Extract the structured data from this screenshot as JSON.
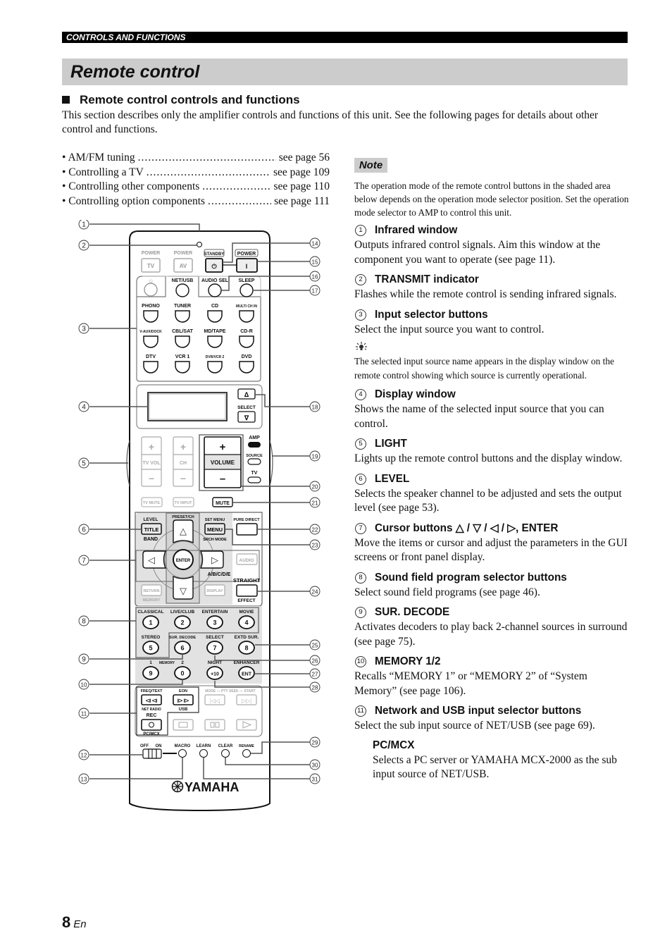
{
  "header": {
    "section": "CONTROLS AND FUNCTIONS"
  },
  "title": "Remote control",
  "section_heading": "Remote control controls and functions",
  "intro": "This section describes only the amplifier controls and functions of this unit. See the following pages for details about other control and functions.",
  "references": [
    {
      "label": "• AM/FM tuning",
      "page": "see page 56"
    },
    {
      "label": "• Controlling a TV",
      "page": "see page 109"
    },
    {
      "label": "• Controlling other components",
      "page": "see page 110"
    },
    {
      "label": "• Controlling option components",
      "page": "see page 111"
    }
  ],
  "note": {
    "label": "Note",
    "text": "The operation mode of the remote control buttons in the shaded area below depends on the operation mode selector position. Set the operation mode selector to AMP to control this unit."
  },
  "items": [
    {
      "num": "1",
      "title": "Infrared window",
      "body": "Outputs infrared control signals. Aim this window at the component you want to operate (see page 11)."
    },
    {
      "num": "2",
      "title": "TRANSMIT indicator",
      "body": "Flashes while the remote control is sending infrared signals."
    },
    {
      "num": "3",
      "title": "Input selector buttons",
      "body": "Select the input source you want to control.",
      "tip_icon": "lightbulb-icon",
      "tip": "The selected input source name appears in the display window on the remote control showing which source is currently operational."
    },
    {
      "num": "4",
      "title": "Display window",
      "body": "Shows the name of the selected input source that you can control."
    },
    {
      "num": "5",
      "title": "LIGHT",
      "body": "Lights up the remote control buttons and the display window."
    },
    {
      "num": "6",
      "title": "LEVEL",
      "body": "Selects the speaker channel to be adjusted and sets the output level (see page 53)."
    },
    {
      "num": "7",
      "title": "Cursor buttons △ / ▽ / ◁ / ▷, ENTER",
      "body": "Move the items or cursor and adjust the parameters in the GUI screens or front panel display."
    },
    {
      "num": "8",
      "title": "Sound field program selector buttons",
      "body": "Select sound field programs (see page 46)."
    },
    {
      "num": "9",
      "title": "SUR. DECODE",
      "body": "Activates decoders to play back 2-channel sources in surround (see page 75)."
    },
    {
      "num": "10",
      "title": "MEMORY 1/2",
      "body": "Recalls “MEMORY 1” or “MEMORY 2” of “System Memory” (see page 106)."
    },
    {
      "num": "11",
      "title": "Network and USB input selector buttons",
      "body": "Select the sub input source of NET/USB (see page 69).",
      "sub": {
        "title": "PC/MCX",
        "body": "Selects a PC server or YAMAHA MCX-2000 as the sub input source of NET/USB."
      }
    }
  ],
  "remote": {
    "power_labels": [
      "POWER",
      "POWER",
      "STANDBY",
      "POWER"
    ],
    "power_buttons": [
      "TV",
      "AV",
      "⏻",
      "I"
    ],
    "star": "☆",
    "top_row": [
      "NET/USB",
      "AUDIO SEL",
      "SLEEP"
    ],
    "inputs": [
      [
        "PHONO",
        "TUNER",
        "CD",
        "MULTI CH IN"
      ],
      [
        "V-AUX/DOCK",
        "CBL/SAT",
        "MD/TAPE",
        "CD-R"
      ],
      [
        "DTV",
        "VCR 1",
        "DVR/VCR 2",
        "DVD"
      ]
    ],
    "select_label": "SELECT",
    "select_up": "Δ",
    "select_down": "∇",
    "plus": "+",
    "minus": "–",
    "tv_vol": "TV VOL",
    "ch": "CH",
    "volume": "VOLUME",
    "mode_labels": [
      "AMP",
      "SOURCE",
      "TV"
    ],
    "tv_mute": "TV MUTE",
    "tv_input": "TV INPUT",
    "mute": "MUTE",
    "level": "LEVEL",
    "title_btn": "TITLE",
    "band": "BAND",
    "preset_ch": "PRESET/CH",
    "set_menu": "SET MENU",
    "menu_btn": "MENU",
    "srch_mode": "SRCH MODE",
    "pure_direct": "PURE DIRECT",
    "enter": "ENTER",
    "audio": "AUDIO",
    "abcde": "A/B/C/D/E",
    "straight": "STRAIGHT",
    "effect": "EFFECT",
    "return_btn": "RETURN",
    "memory_sub": "MEMORY",
    "display_btn": "DISPLAY",
    "programs": [
      "CLASSICAL",
      "LIVE/CLUB",
      "ENTERTAIN",
      "MOVIE",
      "STEREO",
      "SUR. DECODE",
      "SELECT",
      "EXTD SUR."
    ],
    "numbers": [
      "1",
      "2",
      "3",
      "4",
      "5",
      "6",
      "7",
      "8",
      "9",
      "0",
      "+10",
      "ENT"
    ],
    "memory_row": [
      "1",
      "MEMORY",
      "2",
      "NIGHT",
      "ENHANCER"
    ],
    "freq_text": "FREQ/TEXT",
    "eon": "EON",
    "net_radio": "NET RADIO",
    "usb": "USB",
    "rec": "REC",
    "pc_mcx": "PC/MCX",
    "mode_pty": "MODE — PTY SEEK — START",
    "off": "OFF",
    "on": "ON",
    "bottom": [
      "MACRO",
      "LEARN",
      "CLEAR",
      "RENAME"
    ],
    "brand": "YAMAHA",
    "callouts_left": [
      "1",
      "2",
      "3",
      "4",
      "5",
      "6",
      "7",
      "8",
      "9",
      "10",
      "11",
      "12",
      "13"
    ],
    "callouts_right": [
      "14",
      "15",
      "16",
      "17",
      "18",
      "19",
      "20",
      "21",
      "22",
      "23",
      "24",
      "25",
      "26",
      "27",
      "28",
      "29",
      "30",
      "31"
    ]
  },
  "page": {
    "number": "8",
    "lang": "En"
  }
}
